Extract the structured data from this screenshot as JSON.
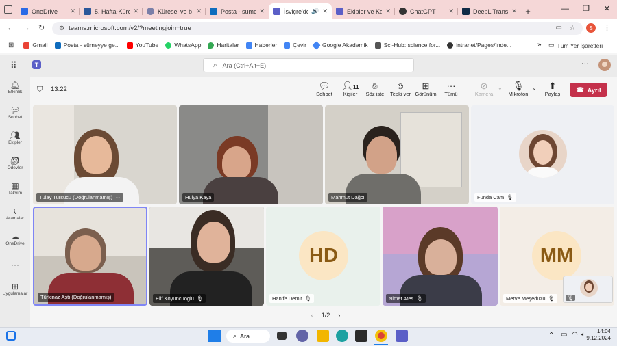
{
  "browser": {
    "tabs": [
      {
        "label": "OneDrive",
        "color": "#2b6ae6"
      },
      {
        "label": "5. Hafta-Küresel",
        "color": "#2b579a"
      },
      {
        "label": "Küresel ve b",
        "color": "#7a7fa8"
      },
      {
        "label": "Posta - sume",
        "color": "#0f6cbd"
      },
      {
        "label": "İsviçre'de",
        "color": "#5b5fc7"
      },
      {
        "label": "Ekipler ve Ka",
        "color": "#5b5fc7"
      },
      {
        "label": "ChatGPT",
        "color": "#333333"
      },
      {
        "label": "DeepL Transl",
        "color": "#0f2b46"
      }
    ],
    "url": "teams.microsoft.com/v2/?meetingjoin=true",
    "profile_letter": "S",
    "bookmarks": [
      {
        "label": "Gmail",
        "color": "#ea4335"
      },
      {
        "label": "Posta - sümeyye ge...",
        "color": "#0f6cbd"
      },
      {
        "label": "YouTube",
        "color": "#ff0000"
      },
      {
        "label": "WhatsApp",
        "color": "#25d366"
      },
      {
        "label": "Haritalar",
        "color": "#34a853"
      },
      {
        "label": "Haberler",
        "color": "#4285f4"
      },
      {
        "label": "Çevir",
        "color": "#4285f4"
      },
      {
        "label": "Google Akademik",
        "color": "#4285f4"
      },
      {
        "label": "Sci-Hub: science for...",
        "color": "#555555"
      },
      {
        "label": "intranet/Pages/Inde...",
        "color": "#333333"
      }
    ],
    "all_bookmarks": "Tüm Yer İşaretleri"
  },
  "teams": {
    "search_placeholder": "Ara (Ctrl+Alt+E)",
    "rail": [
      {
        "label": "Etkinlik",
        "icon": "bell-icon"
      },
      {
        "label": "Sohbet",
        "icon": "chat-icon"
      },
      {
        "label": "Ekipler",
        "icon": "teams-icon"
      },
      {
        "label": "Ödevler",
        "icon": "assignments-icon"
      },
      {
        "label": "Takvim",
        "icon": "calendar-icon"
      },
      {
        "label": "Aramalar",
        "icon": "phone-icon"
      },
      {
        "label": "OneDrive",
        "icon": "cloud-icon"
      },
      {
        "label": "Uygulamalar",
        "icon": "apps-icon"
      }
    ],
    "meeting": {
      "time": "13:22",
      "toolbar": {
        "chat": "Sohbet",
        "people": "Kişiler",
        "people_count": "11",
        "raise": "Söz iste",
        "react": "Tepki ver",
        "view": "Görünüm",
        "more": "Tümü",
        "camera": "Kamera",
        "mic": "Mikrofon",
        "share": "Paylaş",
        "leave": "Ayrıl"
      },
      "participants": [
        {
          "name": "Tülay Tursucu (Doğrulanmamış)"
        },
        {
          "name": "Hülya Kaya"
        },
        {
          "name": "Mahmut Dağcı"
        },
        {
          "name": "Funda Cam"
        },
        {
          "name": "Türkinaz Aştı (Doğrulanmamış)"
        },
        {
          "name": "Elif Koyuncuoglu"
        },
        {
          "name": "Hanife Demir",
          "initials": "HD"
        },
        {
          "name": "Nimet Ates"
        },
        {
          "name": "Merve Meşedüzü",
          "initials": "MM"
        }
      ],
      "pager": "1/2"
    }
  },
  "taskbar": {
    "search": "Ara",
    "time": "14:04",
    "date": "9.12.2024"
  }
}
